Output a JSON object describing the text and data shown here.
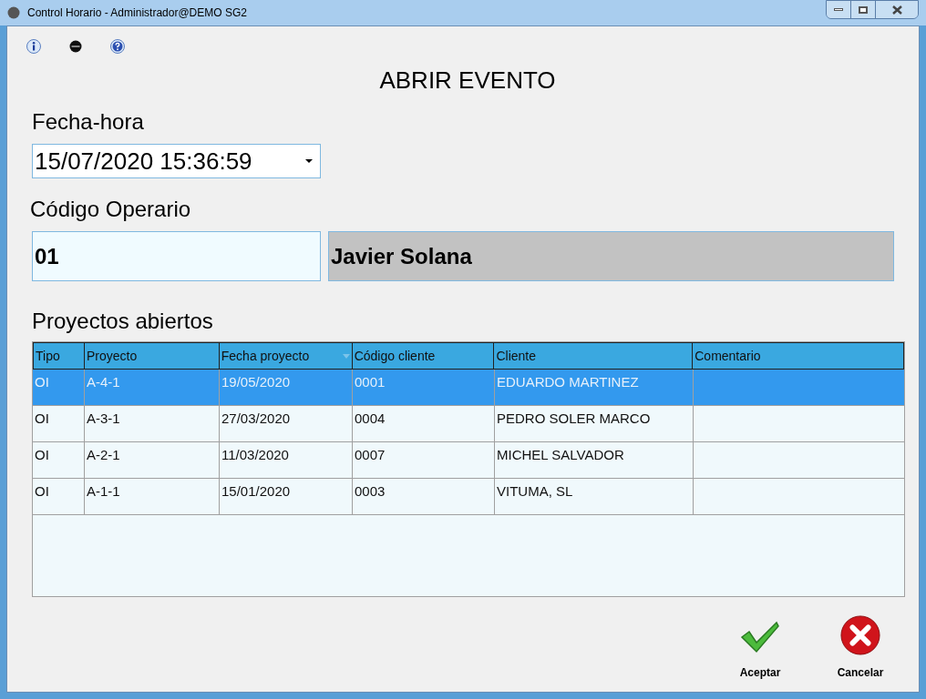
{
  "window": {
    "title": "Control Horario - Administrador@DEMO SG2"
  },
  "heading": "ABRIR EVENTO",
  "datetime": {
    "label": "Fecha-hora",
    "value": "15/07/2020 15:36:59"
  },
  "operator": {
    "label": "Código Operario",
    "code": "01",
    "name": "Javier Solana"
  },
  "projects": {
    "label": "Proyectos abiertos",
    "columns": [
      {
        "label": "Tipo",
        "sorted": false
      },
      {
        "label": "Proyecto",
        "sorted": false
      },
      {
        "label": "Fecha proyecto",
        "sorted": true
      },
      {
        "label": "Código cliente",
        "sorted": false
      },
      {
        "label": "Cliente",
        "sorted": false
      },
      {
        "label": "Comentario",
        "sorted": false
      }
    ],
    "rows": [
      {
        "selected": true,
        "cells": [
          "OI",
          "A-4-1",
          "19/05/2020",
          "0001",
          "EDUARDO MARTINEZ",
          ""
        ]
      },
      {
        "selected": false,
        "cells": [
          "OI",
          "A-3-1",
          "27/03/2020",
          "0004",
          "PEDRO SOLER MARCO",
          ""
        ]
      },
      {
        "selected": false,
        "cells": [
          "OI",
          "A-2-1",
          "11/03/2020",
          "0007",
          "MICHEL SALVADOR",
          ""
        ]
      },
      {
        "selected": false,
        "cells": [
          "OI",
          "A-1-1",
          "15/01/2020",
          "0003",
          "VITUMA, SL",
          ""
        ]
      }
    ]
  },
  "buttons": [
    {
      "kind": "accept",
      "label": "Aceptar"
    },
    {
      "kind": "cancel",
      "label": "Cancelar"
    }
  ]
}
